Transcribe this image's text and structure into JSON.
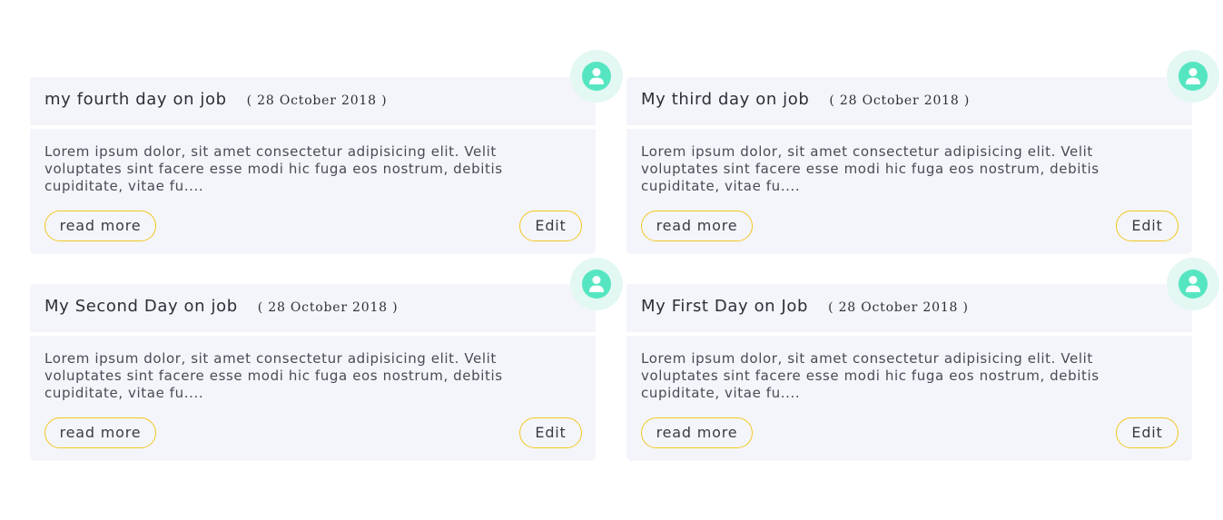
{
  "theme": {
    "card_background": "#f4f5fb",
    "button_border": "#f2c71e",
    "avatar_color": "#55e6c1",
    "avatar_ring": "#e3f7f3"
  },
  "posts": [
    {
      "title": "my fourth day on job",
      "date": "( 28 October 2018 )",
      "excerpt": "Lorem ipsum dolor, sit amet consectetur adipisicing elit. Velit voluptates sint facere esse modi hic fuga eos nostrum, debitis cupiditate, vitae fu....",
      "read_more_label": "read more",
      "edit_label": "Edit",
      "avatar_icon": "user-icon"
    },
    {
      "title": "My third day on job",
      "date": "( 28 October 2018 )",
      "excerpt": "Lorem ipsum dolor, sit amet consectetur adipisicing elit. Velit voluptates sint facere esse modi hic fuga eos nostrum, debitis cupiditate, vitae fu....",
      "read_more_label": "read more",
      "edit_label": "Edit",
      "avatar_icon": "user-icon"
    },
    {
      "title": "My Second Day on job",
      "date": "( 28 October 2018 )",
      "excerpt": "Lorem ipsum dolor, sit amet consectetur adipisicing elit. Velit voluptates sint facere esse modi hic fuga eos nostrum, debitis cupiditate, vitae fu....",
      "read_more_label": "read more",
      "edit_label": "Edit",
      "avatar_icon": "user-icon"
    },
    {
      "title": "My First Day on Job",
      "date": "( 28 October 2018 )",
      "excerpt": "Lorem ipsum dolor, sit amet consectetur adipisicing elit. Velit voluptates sint facere esse modi hic fuga eos nostrum, debitis cupiditate, vitae fu....",
      "read_more_label": "read more",
      "edit_label": "Edit",
      "avatar_icon": "user-icon"
    }
  ]
}
